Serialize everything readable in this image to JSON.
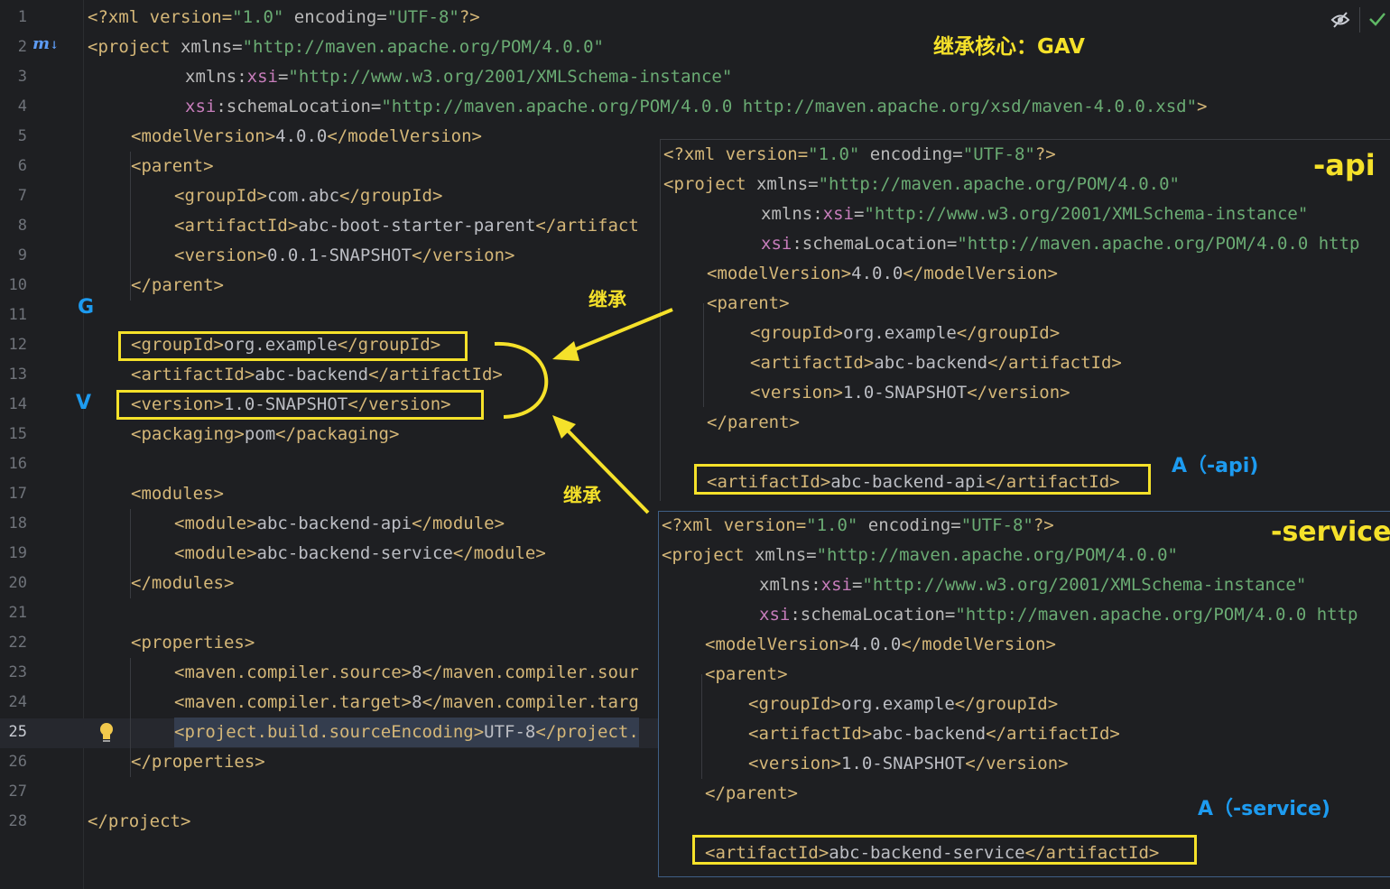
{
  "main_editor": {
    "line_numbers": [
      "1",
      "2",
      "3",
      "4",
      "5",
      "6",
      "7",
      "8",
      "9",
      "10",
      "11",
      "12",
      "13",
      "14",
      "15",
      "16",
      "17",
      "18",
      "19",
      "20",
      "21",
      "22",
      "23",
      "24",
      "25",
      "26",
      "27",
      "28"
    ],
    "active_line": "25",
    "lines": {
      "l1": {
        "p1": "<?xml version=",
        "s1": "\"1.0\"",
        "p2": " encoding=",
        "s2": "\"UTF-8\"",
        "p3": "?>"
      },
      "l2": {
        "t1": "<project",
        "a1": " xmlns=",
        "s1": "\"http://maven.apache.org/POM/4.0.0\""
      },
      "l3": {
        "a1": "xmlns:",
        "ns1": "xsi",
        "a2": "=",
        "s1": "\"http://www.w3.org/2001/XMLSchema-instance\""
      },
      "l4": {
        "ns1": "xsi",
        "a1": ":schemaLocation=",
        "s1": "\"http://maven.apache.org/POM/4.0.0 http://maven.apache.org/xsd/maven-4.0.0.xsd\"",
        "t1": ">"
      },
      "l5": {
        "t1": "<modelVersion>",
        "v": "4.0.0",
        "t2": "</modelVersion>"
      },
      "l6": {
        "t1": "<parent>"
      },
      "l7": {
        "t1": "<groupId>",
        "v": "com.abc",
        "t2": "</groupId>"
      },
      "l8": {
        "t1": "<artifactId>",
        "v": "abc-boot-starter-parent",
        "t2": "</artifact"
      },
      "l9": {
        "t1": "<version>",
        "v": "0.0.1-SNAPSHOT",
        "t2": "</version>"
      },
      "l10": {
        "t1": "</parent>"
      },
      "l12": {
        "t1": "<groupId>",
        "v": "org.example",
        "t2": "</groupId>"
      },
      "l13": {
        "t1": "<artifactId>",
        "v": "abc-backend",
        "t2": "</artifactId>"
      },
      "l14": {
        "t1": "<version>",
        "v": "1.0-SNAPSHOT",
        "t2": "</version>"
      },
      "l15": {
        "t1": "<packaging>",
        "v": "pom",
        "t2": "</packaging>"
      },
      "l17": {
        "t1": "<modules>"
      },
      "l18": {
        "t1": "<module>",
        "v": "abc-backend-api",
        "t2": "</module>"
      },
      "l19": {
        "t1": "<module>",
        "v": "abc-backend-service",
        "t2": "</module>"
      },
      "l20": {
        "t1": "</modules>"
      },
      "l22": {
        "t1": "<properties>"
      },
      "l23": {
        "t1": "<maven.compiler.source>",
        "v": "8",
        "t2": "</maven.compiler.sour"
      },
      "l24": {
        "t1": "<maven.compiler.target>",
        "v": "8",
        "t2": "</maven.compiler.targ"
      },
      "l25": {
        "t1": "<project.build.sourceEncoding>",
        "v": "UTF-8",
        "t2": "</project."
      },
      "l26": {
        "t1": "</properties>"
      },
      "l28": {
        "t1": "</project>"
      }
    }
  },
  "panel_api": {
    "lines": {
      "l1": {
        "p1": "<?xml version=",
        "s1": "\"1.0\"",
        "p2": " encoding=",
        "s2": "\"UTF-8\"",
        "p3": "?>"
      },
      "l2": {
        "t1": "<project",
        "a1": " xmlns=",
        "s1": "\"http://maven.apache.org/POM/4.0.0\""
      },
      "l3": {
        "a1": "xmlns:",
        "ns1": "xsi",
        "a2": "=",
        "s1": "\"http://www.w3.org/2001/XMLSchema-instance\""
      },
      "l4": {
        "ns1": "xsi",
        "a1": ":schemaLocation=",
        "s1": "\"http://maven.apache.org/POM/4.0.0 http"
      },
      "l5": {
        "t1": "<modelVersion>",
        "v": "4.0.0",
        "t2": "</modelVersion>"
      },
      "l6": {
        "t1": "<parent>"
      },
      "l7": {
        "t1": "<groupId>",
        "v": "org.example",
        "t2": "</groupId>"
      },
      "l8": {
        "t1": "<artifactId>",
        "v": "abc-backend",
        "t2": "</artifactId>"
      },
      "l9": {
        "t1": "<version>",
        "v": "1.0-SNAPSHOT",
        "t2": "</version>"
      },
      "l10": {
        "t1": "</parent>"
      },
      "l12": {
        "t1": "<artifactId>",
        "v": "abc-backend-api",
        "t2": "</artifactId>"
      }
    },
    "title": "-api",
    "a_label": "A（-api)"
  },
  "panel_service": {
    "lines": {
      "l1": {
        "p1": "<?xml version=",
        "s1": "\"1.0\"",
        "p2": " encoding=",
        "s2": "\"UTF-8\"",
        "p3": "?>"
      },
      "l2": {
        "t1": "<project",
        "a1": " xmlns=",
        "s1": "\"http://maven.apache.org/POM/4.0.0\""
      },
      "l3": {
        "a1": "xmlns:",
        "ns1": "xsi",
        "a2": "=",
        "s1": "\"http://www.w3.org/2001/XMLSchema-instance\""
      },
      "l4": {
        "ns1": "xsi",
        "a1": ":schemaLocation=",
        "s1": "\"http://maven.apache.org/POM/4.0.0 http"
      },
      "l5": {
        "t1": "<modelVersion>",
        "v": "4.0.0",
        "t2": "</modelVersion>"
      },
      "l6": {
        "t1": "<parent>"
      },
      "l7": {
        "t1": "<groupId>",
        "v": "org.example",
        "t2": "</groupId>"
      },
      "l8": {
        "t1": "<artifactId>",
        "v": "abc-backend",
        "t2": "</artifactId>"
      },
      "l9": {
        "t1": "<version>",
        "v": "1.0-SNAPSHOT",
        "t2": "</version>"
      },
      "l10": {
        "t1": "</parent>"
      },
      "l12": {
        "t1": "<artifactId>",
        "v": "abc-backend-service",
        "t2": "</artifactId>"
      }
    },
    "title": "-service",
    "a_label": "A（-service)"
  },
  "annotations": {
    "gav_title": "继承核心：GAV",
    "g_label": "G",
    "v_label": "V",
    "inherit_top": "继承",
    "inherit_bottom": "继承"
  },
  "colors": {
    "background": "#1e1f22",
    "tag": "#d5b778",
    "string": "#6aab73",
    "namespace": "#c77dbb",
    "annotation_yellow": "#f5e12a",
    "annotation_blue": "#1d9bf0"
  },
  "icons": [
    "maven-icon",
    "reader-mode-icon",
    "check-icon",
    "lightbulb-icon"
  ]
}
